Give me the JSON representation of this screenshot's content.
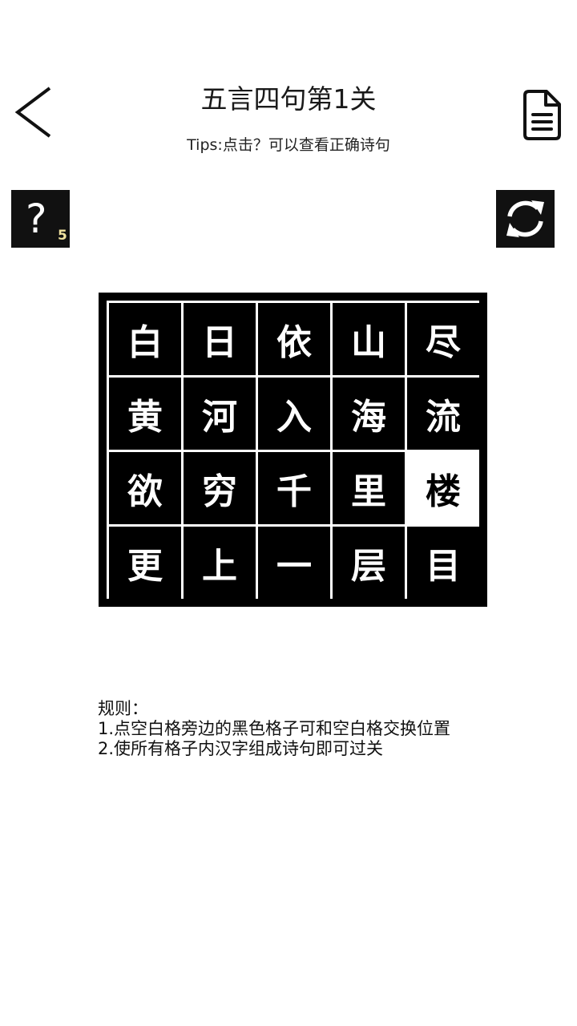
{
  "header": {
    "title": "五言四句第1关",
    "tips": "Tips:点击？可以查看正确诗句"
  },
  "toolbar": {
    "hint_symbol": "?",
    "hint_count": "5"
  },
  "board": {
    "rows": [
      [
        "白",
        "日",
        "依",
        "山",
        "尽"
      ],
      [
        "黄",
        "河",
        "入",
        "海",
        "流"
      ],
      [
        "欲",
        "穷",
        "千",
        "里",
        "楼"
      ],
      [
        "更",
        "上",
        "一",
        "层",
        "目"
      ]
    ],
    "empty_cell": [
      2,
      4
    ]
  },
  "rules": {
    "title": "规则：",
    "lines": [
      "1.点空白格旁边的黑色格子可和空白格交换位置",
      "2.使所有格子内汉字组成诗句即可过关"
    ]
  },
  "colors": {
    "tile": "#000000",
    "empty_tile": "#ffffff",
    "tile_text": "#ffffff",
    "hint_count": "#f1e3a0"
  }
}
